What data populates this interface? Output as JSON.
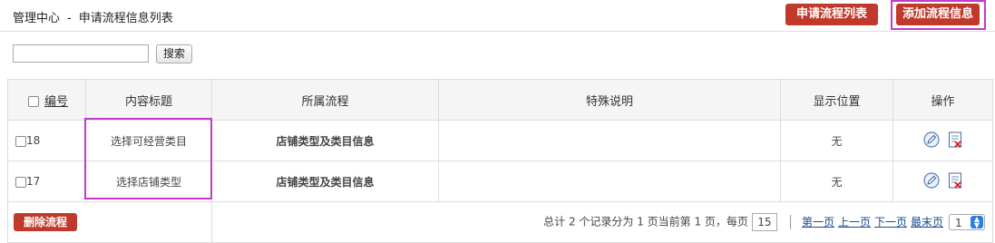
{
  "breadcrumb": {
    "home": "管理中心",
    "sep": "-",
    "current": "申请流程信息列表"
  },
  "header_buttons": {
    "list": "申请流程列表",
    "add": "添加流程信息"
  },
  "search": {
    "value": "",
    "button": "搜索"
  },
  "table": {
    "headers": {
      "id": "编号",
      "title": "内容标题",
      "flow": "所属流程",
      "note": "特殊说明",
      "position": "显示位置",
      "ops": "操作"
    },
    "rows": [
      {
        "id": "18",
        "title": "选择可经营类目",
        "flow": "店铺类型及类目信息",
        "note": "",
        "position": "无"
      },
      {
        "id": "17",
        "title": "选择店铺类型",
        "flow": "店铺类型及类目信息",
        "note": "",
        "position": "无"
      }
    ]
  },
  "footer": {
    "delete_button": "删除流程",
    "summary": "总计 2 个记录分为 1 页当前第 1 页，每页",
    "page_size": "15",
    "first": "第一页",
    "prev": "上一页",
    "next": "下一页",
    "last": "最末页",
    "page_select": "1"
  },
  "colors": {
    "accent": "#c0392b",
    "highlight": "#c43ac9",
    "link": "#1a4b8c"
  },
  "icons": {
    "edit": "edit-icon",
    "delete": "delete-icon"
  }
}
